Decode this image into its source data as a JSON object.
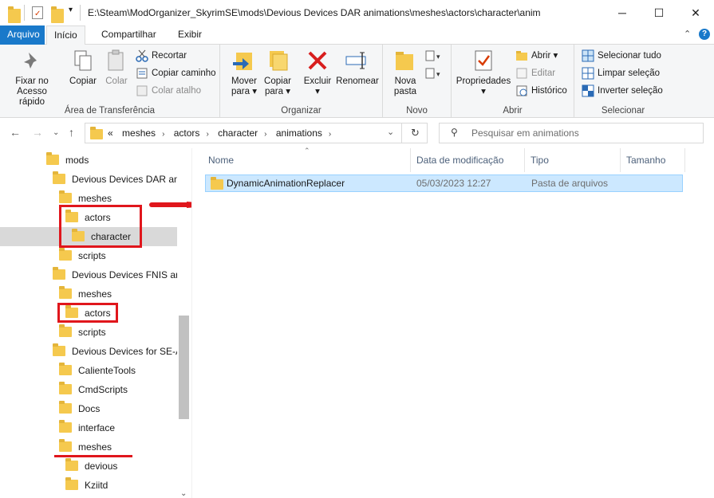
{
  "window": {
    "path": "E:\\Steam\\ModOrganizer_SkyrimSE\\mods\\Devious Devices DAR animations\\meshes\\actors\\character\\anim",
    "minimize": "─",
    "maximize": "☐",
    "close": "✕"
  },
  "tabs": {
    "file": "Arquivo",
    "home": "Início",
    "share": "Compartilhar",
    "view": "Exibir"
  },
  "ribbon": {
    "clipboard": {
      "label": "Área de Transferência",
      "pin": [
        "Fixar no",
        "Acesso rápido"
      ],
      "copy": "Copiar",
      "paste": "Colar",
      "cut": "Recortar",
      "copy_path": "Copiar caminho",
      "paste_shortcut": "Colar atalho"
    },
    "organize": {
      "label": "Organizar",
      "move_to": [
        "Mover",
        "para ▾"
      ],
      "copy_to": [
        "Copiar",
        "para ▾"
      ],
      "delete": [
        "Excluir",
        "▾"
      ],
      "rename": "Renomear"
    },
    "new": {
      "label": "Novo",
      "new_folder": [
        "Nova",
        "pasta"
      ]
    },
    "open": {
      "label": "Abrir",
      "properties": [
        "Propriedades",
        "▾"
      ],
      "open": "Abrir ▾",
      "edit": "Editar",
      "history": "Histórico"
    },
    "select": {
      "label": "Selecionar",
      "select_all": "Selecionar tudo",
      "clear": "Limpar seleção",
      "invert": "Inverter seleção"
    }
  },
  "address": {
    "crumbs": [
      "«",
      "meshes",
      "actors",
      "character",
      "animations"
    ],
    "search_placeholder": "Pesquisar em animations"
  },
  "tree": [
    {
      "label": "mods",
      "indent": 0
    },
    {
      "label": "Devious Devices DAR animations",
      "indent": 1
    },
    {
      "label": "meshes",
      "indent": 2
    },
    {
      "label": "actors",
      "indent": 3
    },
    {
      "label": "character",
      "indent": 4
    },
    {
      "label": "scripts",
      "indent": 2
    },
    {
      "label": "Devious Devices FNIS animations",
      "indent": 1
    },
    {
      "label": "meshes",
      "indent": 2
    },
    {
      "label": "actors",
      "indent": 3
    },
    {
      "label": "scripts",
      "indent": 2
    },
    {
      "label": "Devious Devices for SE-AE",
      "indent": 1
    },
    {
      "label": "CalienteTools",
      "indent": 2
    },
    {
      "label": "CmdScripts",
      "indent": 2
    },
    {
      "label": "Docs",
      "indent": 2
    },
    {
      "label": "interface",
      "indent": 2
    },
    {
      "label": "meshes",
      "indent": 2
    },
    {
      "label": "devious",
      "indent": 3
    },
    {
      "label": "Kziitd",
      "indent": 3
    }
  ],
  "columns": {
    "name": "Nome",
    "date": "Data de modificação",
    "type": "Tipo",
    "size": "Tamanho"
  },
  "files": [
    {
      "name": "DynamicAnimationReplacer",
      "date": "05/03/2023 12:27",
      "type": "Pasta de arquivos",
      "size": ""
    }
  ],
  "colors": {
    "accent": "#1979ca",
    "annotation": "#e0161c",
    "selection": "#cce8ff"
  }
}
